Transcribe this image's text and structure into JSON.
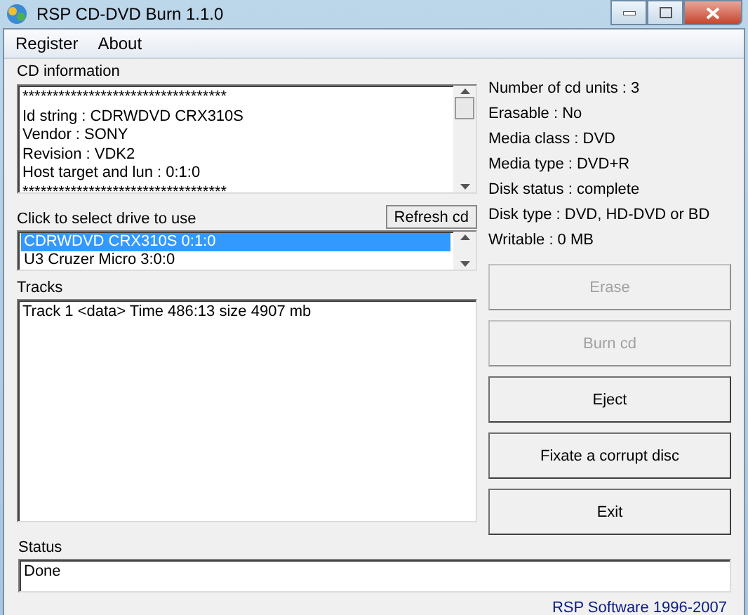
{
  "window": {
    "title": "RSP CD-DVD Burn 1.1.0"
  },
  "menu": [
    "Register",
    "About"
  ],
  "cd_information": {
    "label": "CD information",
    "lines": [
      "**********************************",
      "Id string : CDRWDVD CRX310S",
      "Vendor : SONY",
      "Revision : VDK2",
      "Host target and lun : 0:1:0",
      "**********************************"
    ]
  },
  "drives": {
    "label": "Click to select drive to use",
    "refresh_button": "Refresh cd",
    "items": [
      {
        "label": "CDRWDVD CRX310S 0:1:0",
        "selected": true
      },
      {
        "label": "U3 Cruzer Micro 3:0:0",
        "selected": false
      }
    ]
  },
  "tracks": {
    "label": "Tracks",
    "items": [
      "Track 1 <data> Time 486:13 size 4907 mb"
    ]
  },
  "media_info": [
    "Number of cd units : 3",
    "Erasable :  No",
    "Media class : DVD",
    "Media type :  DVD+R",
    "Disk status :  complete",
    "Disk type :  DVD, HD-DVD or BD",
    "Writable : 0 MB"
  ],
  "buttons": [
    {
      "label": "Erase",
      "disabled": true
    },
    {
      "label": "Burn cd",
      "disabled": true
    },
    {
      "label": "Eject",
      "disabled": false
    },
    {
      "label": "Fixate a corrupt disc",
      "disabled": false
    },
    {
      "label": "Exit",
      "disabled": false
    }
  ],
  "status": {
    "label": "Status",
    "value": "Done"
  },
  "footer": "RSP Software 1996-2007"
}
